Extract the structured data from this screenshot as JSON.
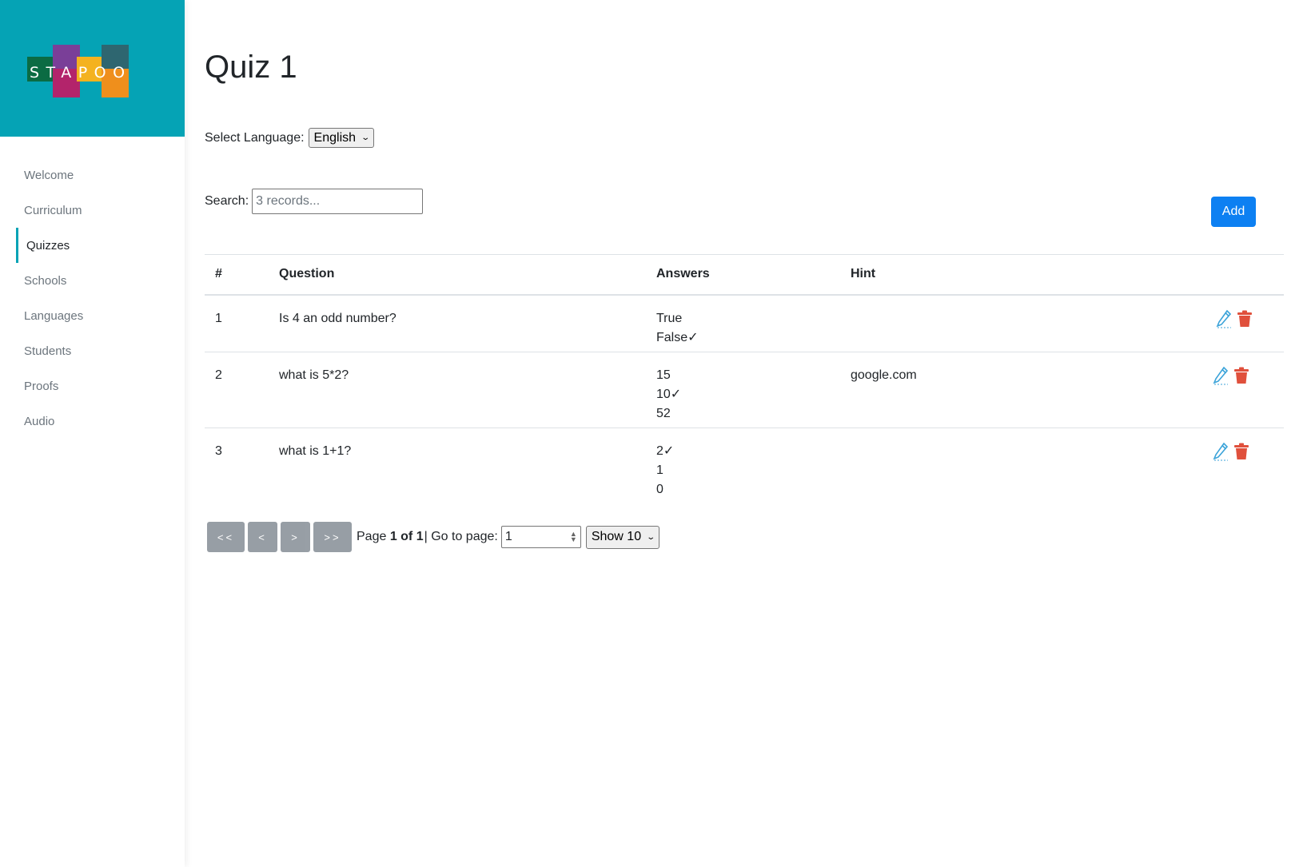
{
  "brand": {
    "name": "STAPOO"
  },
  "sidebar": {
    "items": [
      {
        "label": "Welcome",
        "active": false
      },
      {
        "label": "Curriculum",
        "active": false
      },
      {
        "label": "Quizzes",
        "active": true
      },
      {
        "label": "Schools",
        "active": false
      },
      {
        "label": "Languages",
        "active": false
      },
      {
        "label": "Students",
        "active": false
      },
      {
        "label": "Proofs",
        "active": false
      },
      {
        "label": "Audio",
        "active": false
      }
    ]
  },
  "page": {
    "title": "Quiz 1"
  },
  "language": {
    "label": "Select Language:",
    "selected": "English"
  },
  "search": {
    "label": "Search:",
    "placeholder": "3 records..."
  },
  "toolbar": {
    "add_label": "Add"
  },
  "table": {
    "headers": {
      "num": "#",
      "question": "Question",
      "answers": "Answers",
      "hint": "Hint"
    },
    "rows": [
      {
        "num": "1",
        "question": "Is 4 an odd number?",
        "answers": [
          "True",
          "False✓"
        ],
        "hint": ""
      },
      {
        "num": "2",
        "question": "what is 5*2?",
        "answers": [
          "15",
          "10✓",
          "52"
        ],
        "hint": "google.com"
      },
      {
        "num": "3",
        "question": "what is 1+1?",
        "answers": [
          "2✓",
          "1",
          "0"
        ],
        "hint": ""
      }
    ]
  },
  "pagination": {
    "first": "<<",
    "prev": "<",
    "next": ">",
    "last": ">>",
    "page_prefix": "Page ",
    "page_of": "1 of 1",
    "goto_label": "| Go to page:",
    "goto_value": "1",
    "show_label": "Show 10"
  },
  "icons": {
    "edit": "pencil-icon",
    "delete": "trash-icon"
  },
  "colors": {
    "brand": "#05a3b5",
    "primary": "#0d80f2",
    "edit": "#3ba3d9",
    "delete": "#e0503c"
  }
}
